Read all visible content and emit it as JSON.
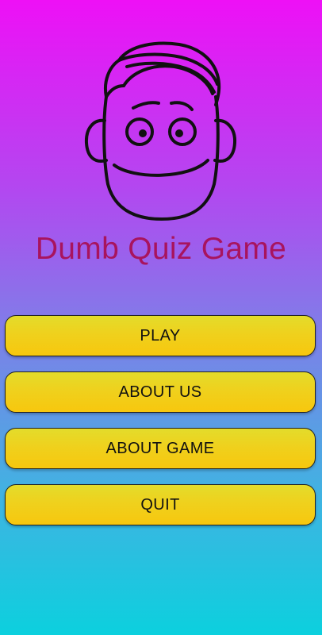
{
  "app": {
    "title": "Dumb Quiz Game",
    "logo_icon": "cartoon-face-icon"
  },
  "menu": {
    "items": [
      {
        "label": "PLAY"
      },
      {
        "label": "ABOUT US"
      },
      {
        "label": "ABOUT GAME"
      },
      {
        "label": "QUIT"
      }
    ]
  },
  "colors": {
    "background_top": "#ee10f6",
    "background_bottom": "#0cd0de",
    "title": "#a8145e",
    "button_fill": "#efd11d",
    "button_border": "#222222"
  }
}
